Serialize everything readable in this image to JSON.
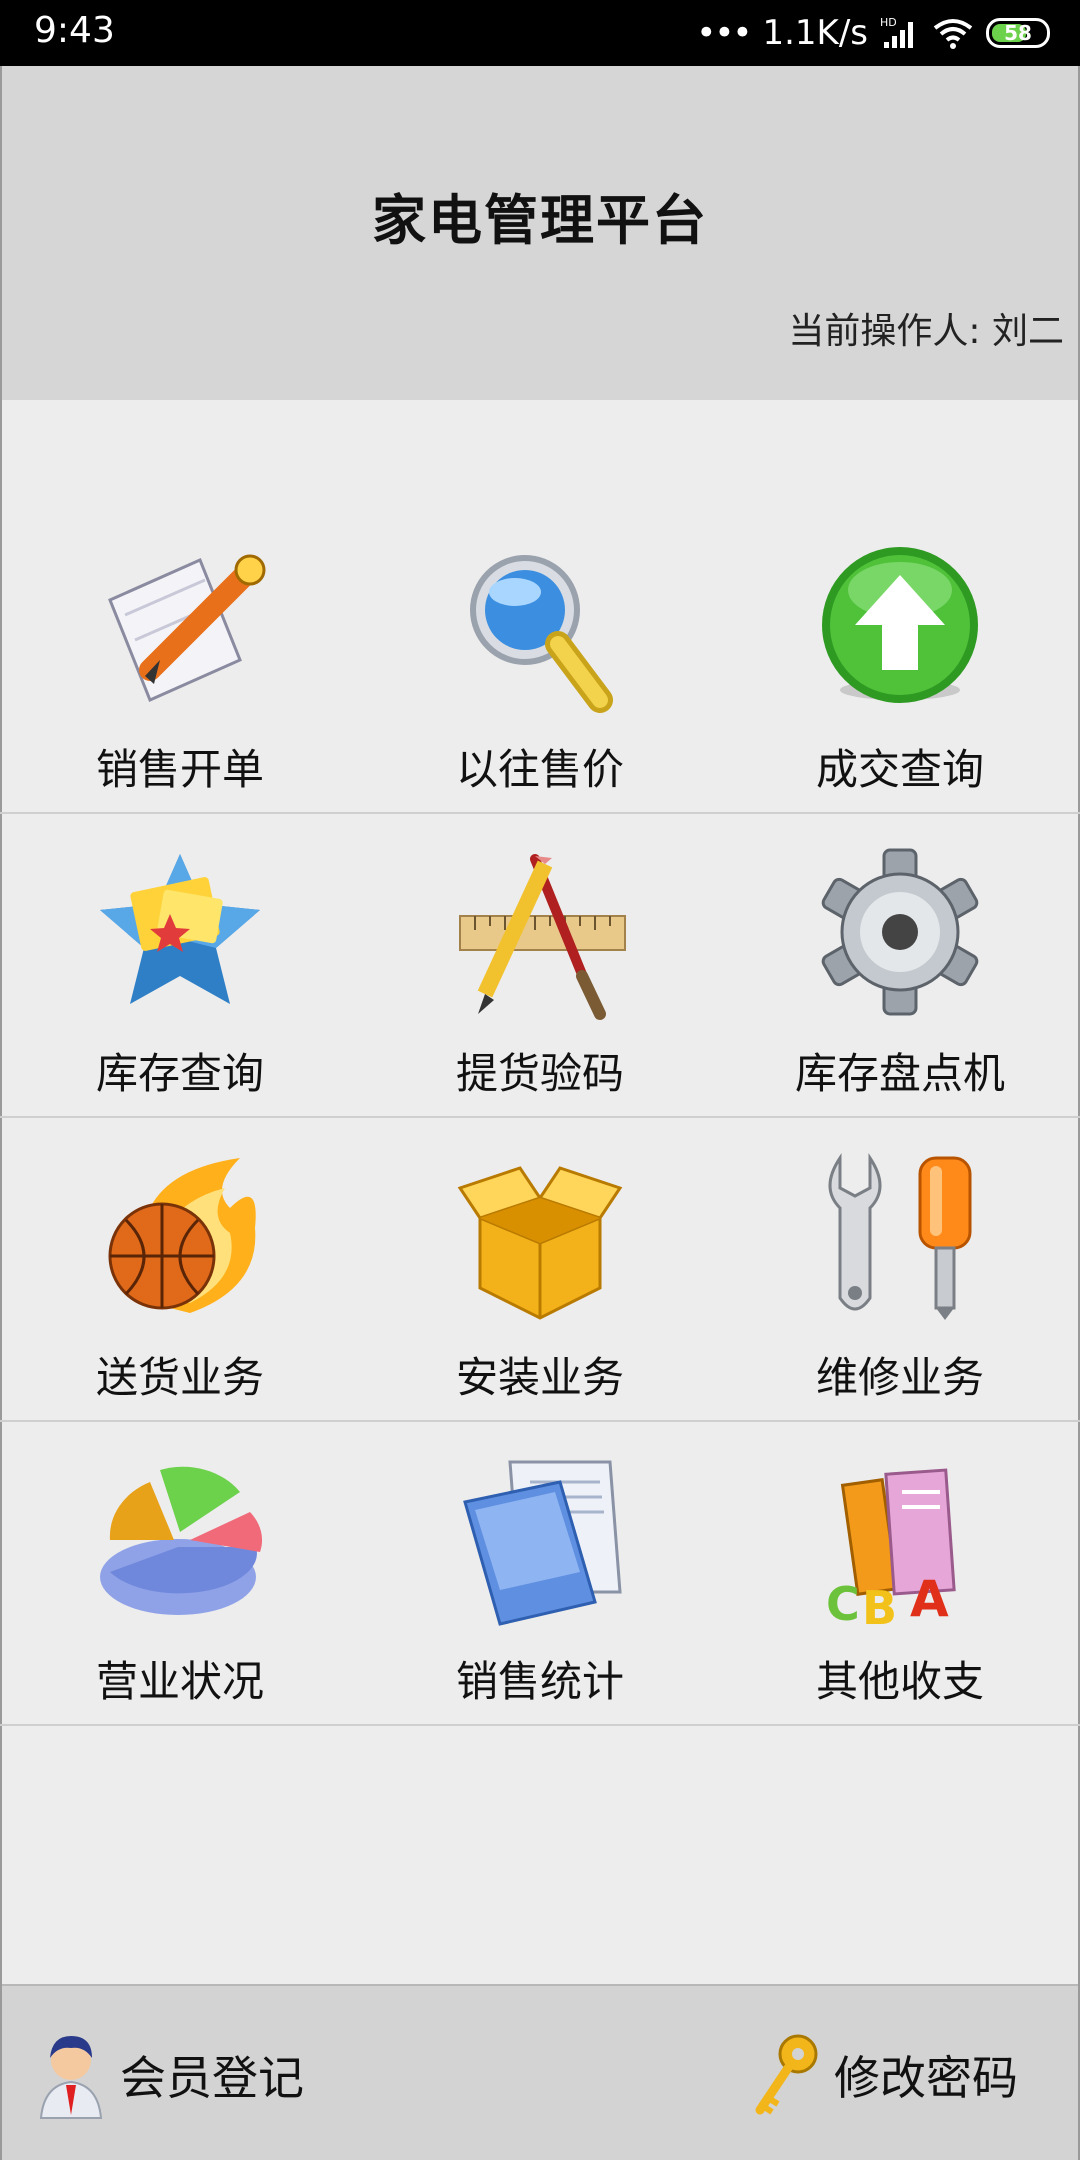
{
  "status_bar": {
    "time": "9:43",
    "net_speed": "1.1K/s",
    "hd_label": "HD",
    "battery": "58"
  },
  "header": {
    "title": "家电管理平台",
    "operator_label": "当前操作人: 刘二"
  },
  "grid": {
    "items": [
      {
        "label": "销售开单",
        "icon": "document-pen-icon"
      },
      {
        "label": "以往售价",
        "icon": "magnifier-icon"
      },
      {
        "label": "成交查询",
        "icon": "green-up-arrow-icon"
      },
      {
        "label": "库存查询",
        "icon": "star-cards-icon"
      },
      {
        "label": "提货验码",
        "icon": "ruler-pencil-icon"
      },
      {
        "label": "库存盘点机",
        "icon": "gear-icon"
      },
      {
        "label": "送货业务",
        "icon": "flaming-basketball-icon"
      },
      {
        "label": "安装业务",
        "icon": "open-box-icon"
      },
      {
        "label": "维修业务",
        "icon": "wrench-screwdriver-icon"
      },
      {
        "label": "营业状况",
        "icon": "pie-chart-icon"
      },
      {
        "label": "销售统计",
        "icon": "document-book-icon"
      },
      {
        "label": "其他收支",
        "icon": "books-abc-icon"
      }
    ]
  },
  "bottom_bar": {
    "member_register": "会员登记",
    "change_password": "修改密码"
  },
  "colors": {
    "status_bar_bg": "#000000",
    "header_bg": "#d6d6d6",
    "body_bg": "#ededed",
    "bottom_bar_bg": "#d3d3d3"
  }
}
